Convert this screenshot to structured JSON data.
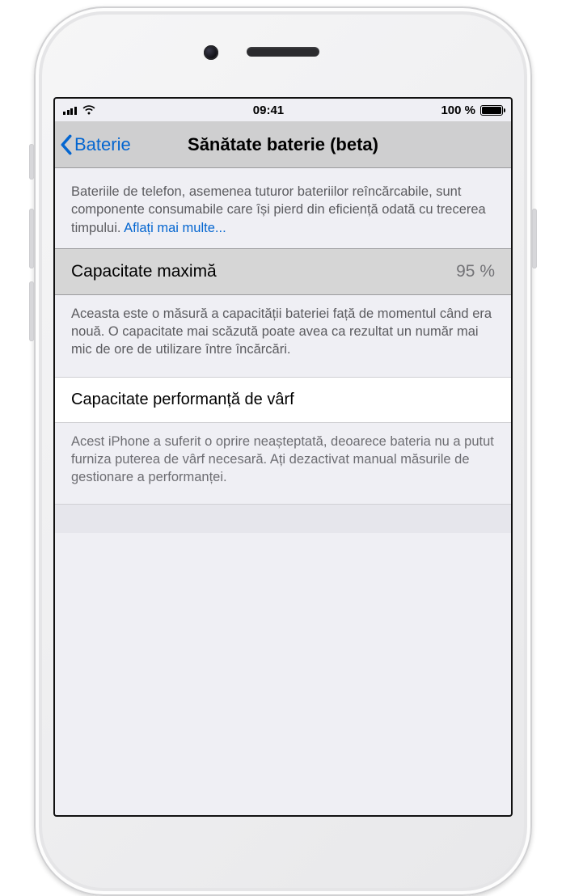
{
  "status": {
    "time": "09:41",
    "battery_text": "100 %"
  },
  "nav": {
    "back_label": "Baterie",
    "title": "Sănătate baterie (beta)"
  },
  "intro": {
    "text": "Bateriile de telefon, asemenea tuturor bateriilor reîncărcabile, sunt componente consumabile care își pierd din eficiență odată cu trecerea timpului. ",
    "link": "Aflați mai multe..."
  },
  "capacity": {
    "label": "Capacitate maximă",
    "value": "95 %",
    "footer": "Aceasta este o măsură a capacității bateriei față de momentul când era nouă. O capacitate mai scăzută poate avea ca rezultat un număr mai mic de ore de utilizare între încărcări."
  },
  "peak": {
    "label": "Capacitate performanță de vârf",
    "footer": "Acest iPhone a suferit o oprire neașteptată, deoarece bateria nu a putut furniza puterea de vârf necesară. Ați dezactivat manual măsurile de gestionare a performanței."
  }
}
